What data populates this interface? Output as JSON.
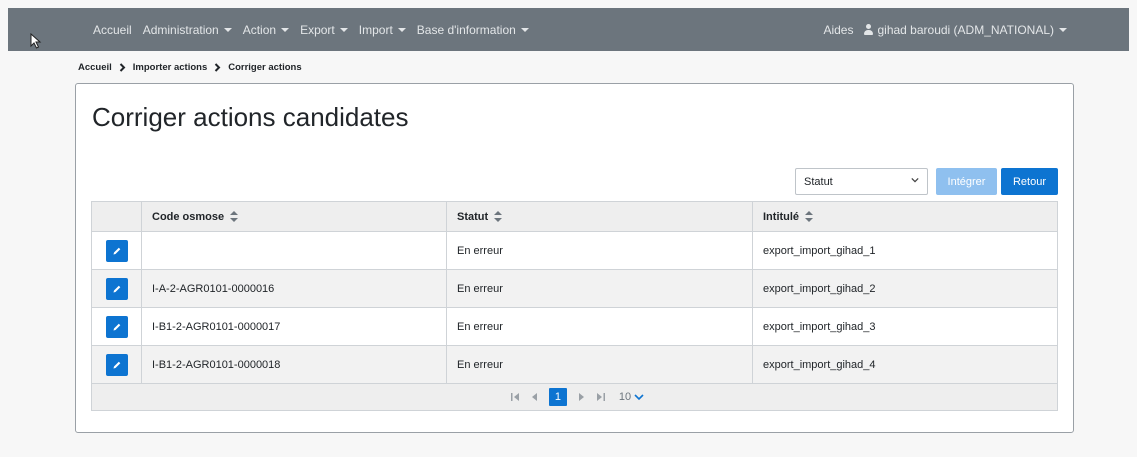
{
  "nav": {
    "items": [
      {
        "label": "Accueil",
        "caret": false
      },
      {
        "label": "Administration",
        "caret": true
      },
      {
        "label": "Action",
        "caret": true
      },
      {
        "label": "Export",
        "caret": true
      },
      {
        "label": "Import",
        "caret": true
      },
      {
        "label": "Base d'information",
        "caret": true
      }
    ],
    "help_label": "Aides",
    "user_label": "gihad baroudi (ADM_NATIONAL)"
  },
  "breadcrumb": [
    "Accueil",
    "Importer actions",
    "Corriger actions"
  ],
  "page_title": "Corriger actions candidates",
  "toolbar": {
    "status_select_value": "Statut",
    "integrate_label": "Intégrer",
    "back_label": "Retour"
  },
  "table": {
    "headers": [
      "Code osmose",
      "Statut",
      "Intitulé"
    ],
    "rows": [
      {
        "code": "",
        "statut": "En erreur",
        "intitule": "export_import_gihad_1"
      },
      {
        "code": "I-A-2-AGR0101-0000016",
        "statut": "En erreur",
        "intitule": "export_import_gihad_2"
      },
      {
        "code": "I-B1-2-AGR0101-0000017",
        "statut": "En erreur",
        "intitule": "export_import_gihad_3"
      },
      {
        "code": "I-B1-2-AGR0101-0000018",
        "statut": "En erreur",
        "intitule": "export_import_gihad_4"
      }
    ]
  },
  "pager": {
    "current_page": "1",
    "page_size": "10"
  },
  "colors": {
    "navbar": "#6c757d",
    "primary": "#0d74d1",
    "primary_disabled": "#8fc0ef"
  }
}
